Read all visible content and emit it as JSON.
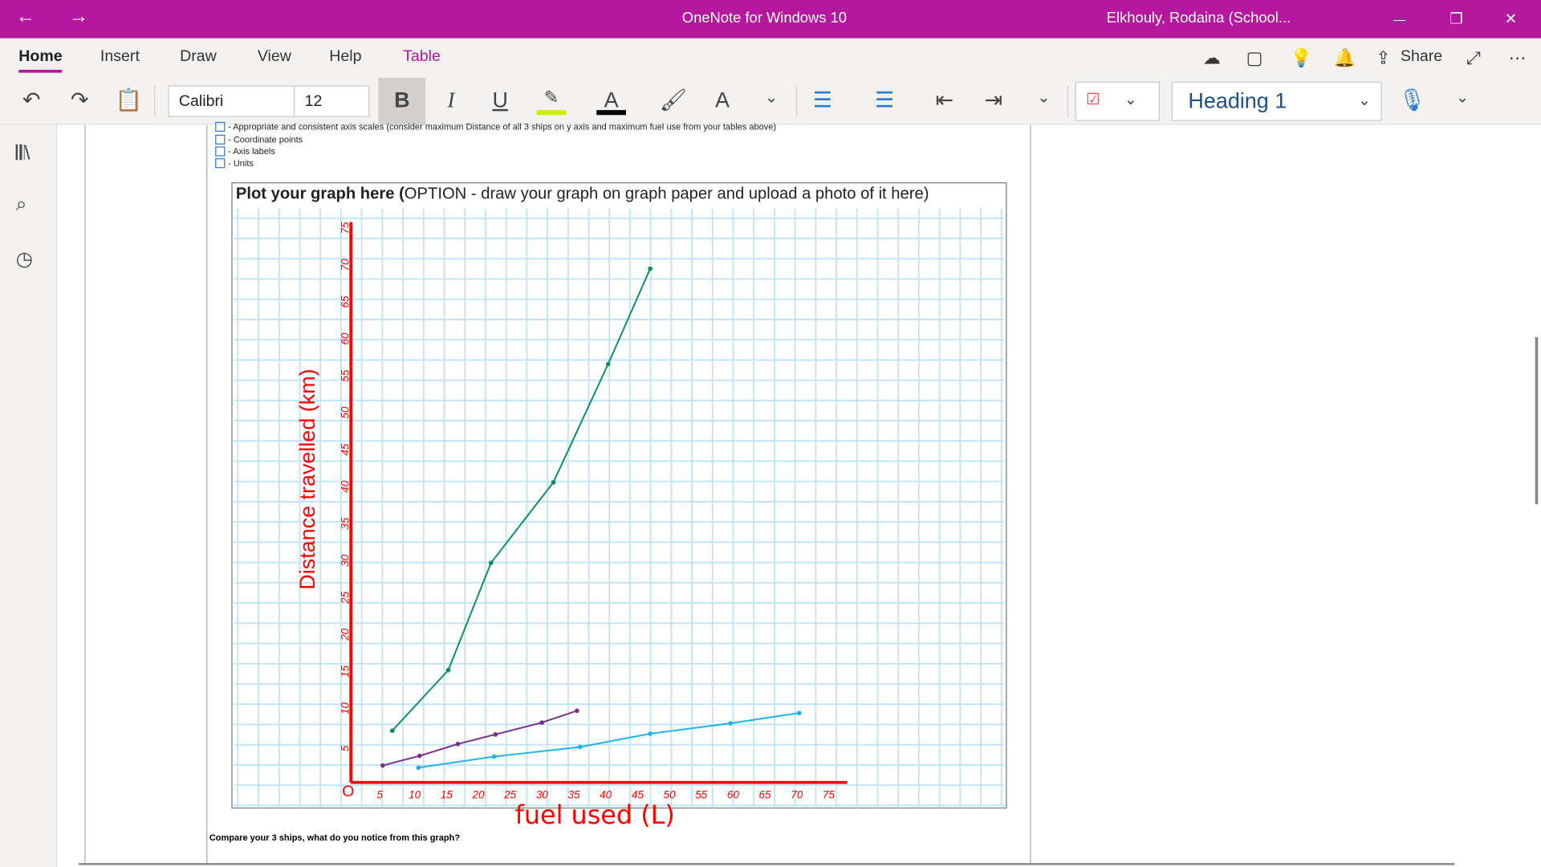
{
  "titlebar": {
    "title": "OneNote for Windows 10",
    "user": "Elkhouly, Rodaina (School...",
    "back": "←",
    "forward": "→",
    "minimize": "—",
    "restore": "❐",
    "close": "✕"
  },
  "menu": [
    {
      "label": "Home"
    },
    {
      "label": "Insert"
    },
    {
      "label": "Draw"
    },
    {
      "label": "View"
    },
    {
      "label": "Help"
    },
    {
      "label": "Table"
    }
  ],
  "menu_right": {
    "share": "Share"
  },
  "ribbon": {
    "font": "Calibri",
    "size": "12",
    "style": "Heading 1",
    "bold": "B",
    "italic": "I",
    "underline": "U",
    "highlight_color": "#c8f000",
    "font_color": "#000000"
  },
  "note": {
    "checklist": [
      "- Appropriate and consistent axis scales (consider maximum Distance of all 3 ships on y axis and maximum fuel use from your tables above)",
      "- Coordinate points",
      "- Axis labels",
      "- Units"
    ],
    "graph_title_bold": "Plot your graph here (",
    "graph_title_rest": "OPTION - draw your graph on graph paper and upload a photo of it here)",
    "question": "Compare your 3 ships, what do you notice from this graph?"
  },
  "chart_data": {
    "type": "line",
    "xlabel": "fuel used (L)",
    "ylabel": "Distance travelled (km)",
    "origin_label": "O",
    "xticks": [
      5,
      10,
      15,
      20,
      25,
      30,
      35,
      40,
      45,
      50,
      55,
      60,
      65,
      70,
      75
    ],
    "yticks": [
      5,
      10,
      15,
      20,
      25,
      30,
      35,
      40,
      45,
      50,
      55,
      60,
      65,
      70,
      75
    ],
    "xlim": [
      0,
      75
    ],
    "ylim": [
      0,
      75
    ],
    "series": [
      {
        "color": "#0a8f5f",
        "points": [
          [
            6.5,
            7
          ],
          [
            15.3,
            15.2
          ],
          [
            22,
            29.7
          ],
          [
            31.8,
            40.6
          ],
          [
            40.4,
            56.6
          ],
          [
            47,
            69.5
          ]
        ]
      },
      {
        "color": "#7b2d8e",
        "points": [
          [
            5,
            2.3
          ],
          [
            10.8,
            3.6
          ],
          [
            16.8,
            5.2
          ],
          [
            22.7,
            6.5
          ],
          [
            30,
            8.1
          ],
          [
            35.5,
            9.7
          ]
        ]
      },
      {
        "color": "#1ab3e6",
        "points": [
          [
            10.6,
            2
          ],
          [
            22.5,
            3.5
          ],
          [
            36,
            4.8
          ],
          [
            47,
            6.6
          ],
          [
            59.6,
            8
          ],
          [
            70.4,
            9.4
          ]
        ]
      }
    ],
    "axis_color": "#ff0000"
  }
}
